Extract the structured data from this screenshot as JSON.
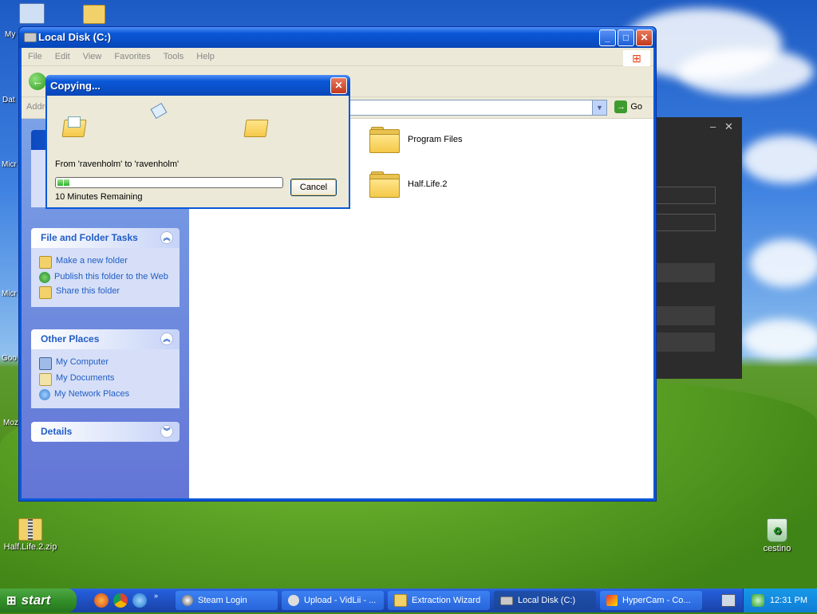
{
  "desktop": {
    "icons": [
      {
        "label": "Half.Life.2.zip"
      },
      {
        "label": "cestino"
      }
    ],
    "partial_labels": [
      "My",
      "Dat",
      "Micr",
      "Micr",
      "Goo",
      "Moz"
    ]
  },
  "explorer": {
    "title": "Local Disk (C:)",
    "menu": [
      "File",
      "Edit",
      "View",
      "Favorites",
      "Tools",
      "Help"
    ],
    "address_label": "Address",
    "go_label": "Go",
    "panels": {
      "file_folder_tasks": {
        "title": "File and Folder Tasks",
        "items": [
          "Make a new folder",
          "Publish this folder to the Web",
          "Share this folder"
        ]
      },
      "other_places": {
        "title": "Other Places",
        "items": [
          "My Computer",
          "My Documents",
          "My Network Places"
        ]
      },
      "details": {
        "title": "Details"
      }
    },
    "files": [
      {
        "name": "Program Files"
      },
      {
        "name": "Half.Life.2"
      }
    ]
  },
  "copy_dialog": {
    "title": "Copying...",
    "from_text": "From 'ravenholm' to 'ravenholm'",
    "progress_fraction": 0.07,
    "remaining_text": "10 Minutes Remaining",
    "cancel_label": "Cancel"
  },
  "taskbar": {
    "start_label": "start",
    "tasks": [
      {
        "label": "Steam Login"
      },
      {
        "label": "Upload - VidLii - ..."
      },
      {
        "label": "Extraction Wizard"
      },
      {
        "label": "Local Disk (C:)"
      },
      {
        "label": "HyperCam - Co..."
      }
    ],
    "clock": "12:31 PM"
  },
  "colors": {
    "xp_blue": "#0a58d8",
    "task_link": "#215dc6",
    "progress_green": "#2db02d"
  }
}
